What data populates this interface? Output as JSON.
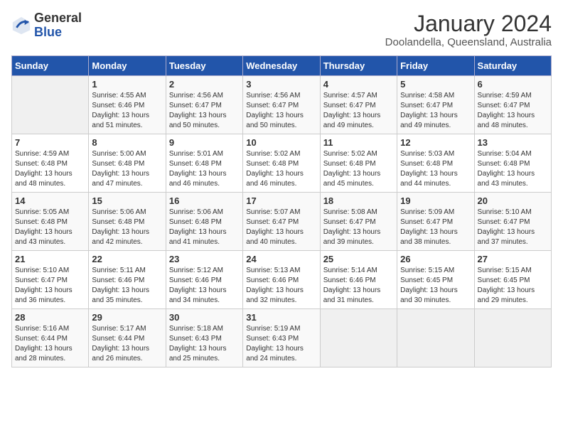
{
  "logo": {
    "general": "General",
    "blue": "Blue"
  },
  "header": {
    "month": "January 2024",
    "location": "Doolandella, Queensland, Australia"
  },
  "days_of_week": [
    "Sunday",
    "Monday",
    "Tuesday",
    "Wednesday",
    "Thursday",
    "Friday",
    "Saturday"
  ],
  "weeks": [
    [
      {
        "day": "",
        "sunrise": "",
        "sunset": "",
        "daylight": ""
      },
      {
        "day": "1",
        "sunrise": "Sunrise: 4:55 AM",
        "sunset": "Sunset: 6:46 PM",
        "daylight": "Daylight: 13 hours and 51 minutes."
      },
      {
        "day": "2",
        "sunrise": "Sunrise: 4:56 AM",
        "sunset": "Sunset: 6:47 PM",
        "daylight": "Daylight: 13 hours and 50 minutes."
      },
      {
        "day": "3",
        "sunrise": "Sunrise: 4:56 AM",
        "sunset": "Sunset: 6:47 PM",
        "daylight": "Daylight: 13 hours and 50 minutes."
      },
      {
        "day": "4",
        "sunrise": "Sunrise: 4:57 AM",
        "sunset": "Sunset: 6:47 PM",
        "daylight": "Daylight: 13 hours and 49 minutes."
      },
      {
        "day": "5",
        "sunrise": "Sunrise: 4:58 AM",
        "sunset": "Sunset: 6:47 PM",
        "daylight": "Daylight: 13 hours and 49 minutes."
      },
      {
        "day": "6",
        "sunrise": "Sunrise: 4:59 AM",
        "sunset": "Sunset: 6:47 PM",
        "daylight": "Daylight: 13 hours and 48 minutes."
      }
    ],
    [
      {
        "day": "7",
        "sunrise": "Sunrise: 4:59 AM",
        "sunset": "Sunset: 6:48 PM",
        "daylight": "Daylight: 13 hours and 48 minutes."
      },
      {
        "day": "8",
        "sunrise": "Sunrise: 5:00 AM",
        "sunset": "Sunset: 6:48 PM",
        "daylight": "Daylight: 13 hours and 47 minutes."
      },
      {
        "day": "9",
        "sunrise": "Sunrise: 5:01 AM",
        "sunset": "Sunset: 6:48 PM",
        "daylight": "Daylight: 13 hours and 46 minutes."
      },
      {
        "day": "10",
        "sunrise": "Sunrise: 5:02 AM",
        "sunset": "Sunset: 6:48 PM",
        "daylight": "Daylight: 13 hours and 46 minutes."
      },
      {
        "day": "11",
        "sunrise": "Sunrise: 5:02 AM",
        "sunset": "Sunset: 6:48 PM",
        "daylight": "Daylight: 13 hours and 45 minutes."
      },
      {
        "day": "12",
        "sunrise": "Sunrise: 5:03 AM",
        "sunset": "Sunset: 6:48 PM",
        "daylight": "Daylight: 13 hours and 44 minutes."
      },
      {
        "day": "13",
        "sunrise": "Sunrise: 5:04 AM",
        "sunset": "Sunset: 6:48 PM",
        "daylight": "Daylight: 13 hours and 43 minutes."
      }
    ],
    [
      {
        "day": "14",
        "sunrise": "Sunrise: 5:05 AM",
        "sunset": "Sunset: 6:48 PM",
        "daylight": "Daylight: 13 hours and 43 minutes."
      },
      {
        "day": "15",
        "sunrise": "Sunrise: 5:06 AM",
        "sunset": "Sunset: 6:48 PM",
        "daylight": "Daylight: 13 hours and 42 minutes."
      },
      {
        "day": "16",
        "sunrise": "Sunrise: 5:06 AM",
        "sunset": "Sunset: 6:48 PM",
        "daylight": "Daylight: 13 hours and 41 minutes."
      },
      {
        "day": "17",
        "sunrise": "Sunrise: 5:07 AM",
        "sunset": "Sunset: 6:47 PM",
        "daylight": "Daylight: 13 hours and 40 minutes."
      },
      {
        "day": "18",
        "sunrise": "Sunrise: 5:08 AM",
        "sunset": "Sunset: 6:47 PM",
        "daylight": "Daylight: 13 hours and 39 minutes."
      },
      {
        "day": "19",
        "sunrise": "Sunrise: 5:09 AM",
        "sunset": "Sunset: 6:47 PM",
        "daylight": "Daylight: 13 hours and 38 minutes."
      },
      {
        "day": "20",
        "sunrise": "Sunrise: 5:10 AM",
        "sunset": "Sunset: 6:47 PM",
        "daylight": "Daylight: 13 hours and 37 minutes."
      }
    ],
    [
      {
        "day": "21",
        "sunrise": "Sunrise: 5:10 AM",
        "sunset": "Sunset: 6:47 PM",
        "daylight": "Daylight: 13 hours and 36 minutes."
      },
      {
        "day": "22",
        "sunrise": "Sunrise: 5:11 AM",
        "sunset": "Sunset: 6:46 PM",
        "daylight": "Daylight: 13 hours and 35 minutes."
      },
      {
        "day": "23",
        "sunrise": "Sunrise: 5:12 AM",
        "sunset": "Sunset: 6:46 PM",
        "daylight": "Daylight: 13 hours and 34 minutes."
      },
      {
        "day": "24",
        "sunrise": "Sunrise: 5:13 AM",
        "sunset": "Sunset: 6:46 PM",
        "daylight": "Daylight: 13 hours and 32 minutes."
      },
      {
        "day": "25",
        "sunrise": "Sunrise: 5:14 AM",
        "sunset": "Sunset: 6:46 PM",
        "daylight": "Daylight: 13 hours and 31 minutes."
      },
      {
        "day": "26",
        "sunrise": "Sunrise: 5:15 AM",
        "sunset": "Sunset: 6:45 PM",
        "daylight": "Daylight: 13 hours and 30 minutes."
      },
      {
        "day": "27",
        "sunrise": "Sunrise: 5:15 AM",
        "sunset": "Sunset: 6:45 PM",
        "daylight": "Daylight: 13 hours and 29 minutes."
      }
    ],
    [
      {
        "day": "28",
        "sunrise": "Sunrise: 5:16 AM",
        "sunset": "Sunset: 6:44 PM",
        "daylight": "Daylight: 13 hours and 28 minutes."
      },
      {
        "day": "29",
        "sunrise": "Sunrise: 5:17 AM",
        "sunset": "Sunset: 6:44 PM",
        "daylight": "Daylight: 13 hours and 26 minutes."
      },
      {
        "day": "30",
        "sunrise": "Sunrise: 5:18 AM",
        "sunset": "Sunset: 6:43 PM",
        "daylight": "Daylight: 13 hours and 25 minutes."
      },
      {
        "day": "31",
        "sunrise": "Sunrise: 5:19 AM",
        "sunset": "Sunset: 6:43 PM",
        "daylight": "Daylight: 13 hours and 24 minutes."
      },
      {
        "day": "",
        "sunrise": "",
        "sunset": "",
        "daylight": ""
      },
      {
        "day": "",
        "sunrise": "",
        "sunset": "",
        "daylight": ""
      },
      {
        "day": "",
        "sunrise": "",
        "sunset": "",
        "daylight": ""
      }
    ]
  ]
}
